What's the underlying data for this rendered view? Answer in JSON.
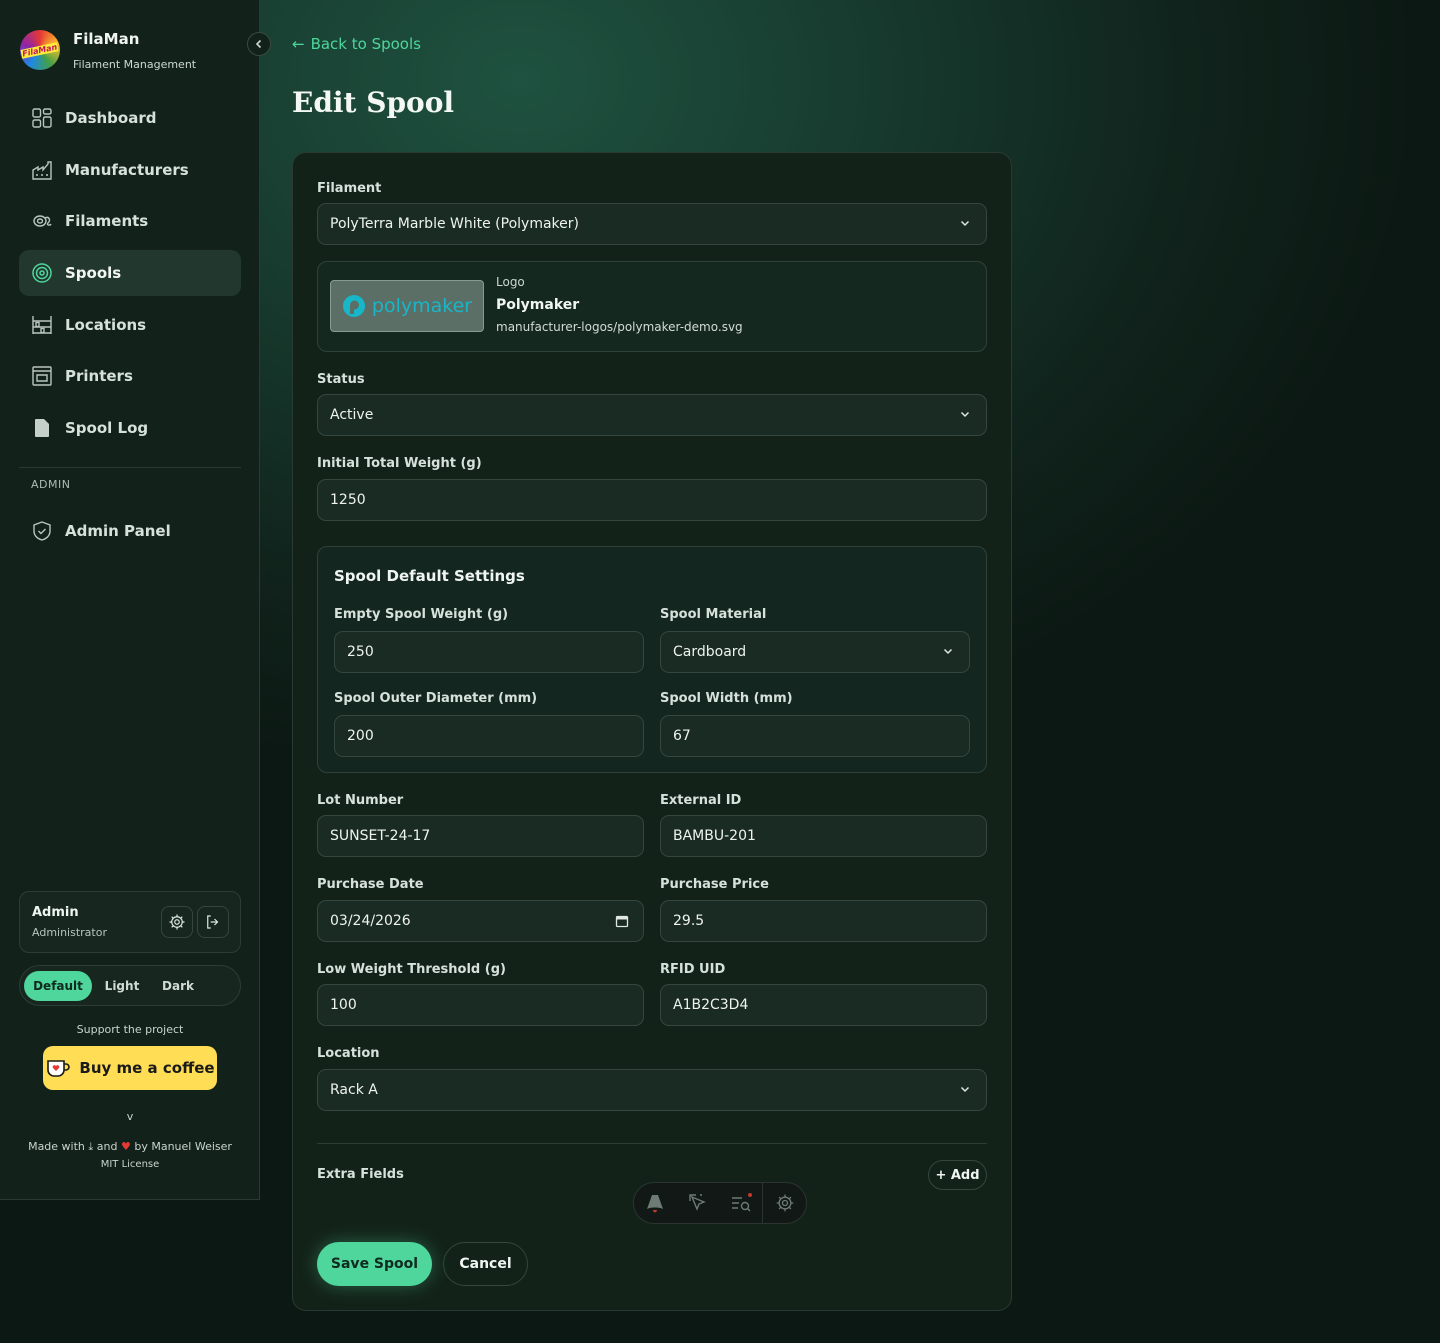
{
  "app": {
    "title": "FilaMan",
    "subtitle": "Filament Management",
    "logo_text": "FilaMan"
  },
  "sidebar": {
    "items": [
      {
        "label": "Dashboard",
        "icon": "dashboard-icon"
      },
      {
        "label": "Manufacturers",
        "icon": "factory-icon"
      },
      {
        "label": "Filaments",
        "icon": "filament-icon"
      },
      {
        "label": "Spools",
        "icon": "spool-icon",
        "active": true
      },
      {
        "label": "Locations",
        "icon": "shelf-icon"
      },
      {
        "label": "Printers",
        "icon": "printer-icon"
      },
      {
        "label": "Spool Log",
        "icon": "document-icon"
      }
    ],
    "admin_section": "ADMIN",
    "admin_item": "Admin Panel"
  },
  "user": {
    "name": "Admin",
    "role": "Administrator"
  },
  "theme": {
    "options": [
      "Default",
      "Light",
      "Dark"
    ],
    "selected": "Default"
  },
  "support": {
    "text": "Support the project",
    "button": "Buy me a coffee"
  },
  "footer": {
    "version": "v",
    "made_prefix": "Made with",
    "made_and": "and",
    "made_by": "by Manuel Weiser",
    "license": "MIT License"
  },
  "page": {
    "back": "Back to Spools",
    "title": "Edit Spool"
  },
  "form": {
    "filament": {
      "label": "Filament",
      "value": "PolyTerra Marble White (Polymaker)"
    },
    "logo": {
      "label": "Logo",
      "name": "Polymaker",
      "path": "manufacturer-logos/polymaker-demo.svg",
      "image_text": "polymaker"
    },
    "status": {
      "label": "Status",
      "value": "Active"
    },
    "initial_weight": {
      "label": "Initial Total Weight (g)",
      "value": "1250"
    },
    "defaults": {
      "title": "Spool Default Settings",
      "empty_weight": {
        "label": "Empty Spool Weight (g)",
        "value": "250"
      },
      "material": {
        "label": "Spool Material",
        "value": "Cardboard"
      },
      "outer_diameter": {
        "label": "Spool Outer Diameter (mm)",
        "value": "200"
      },
      "width": {
        "label": "Spool Width (mm)",
        "value": "67"
      }
    },
    "lot_number": {
      "label": "Lot Number",
      "value": "SUNSET-24-17"
    },
    "external_id": {
      "label": "External ID",
      "value": "BAMBU-201"
    },
    "purchase_date": {
      "label": "Purchase Date",
      "value": "03/24/2026"
    },
    "purchase_price": {
      "label": "Purchase Price",
      "value": "29.5"
    },
    "low_threshold": {
      "label": "Low Weight Threshold (g)",
      "value": "100"
    },
    "rfid": {
      "label": "RFID UID",
      "value": "A1B2C3D4"
    },
    "location": {
      "label": "Location",
      "value": "Rack A"
    },
    "extra_fields": {
      "label": "Extra Fields",
      "add": "+ Add"
    },
    "save": "Save Spool",
    "cancel": "Cancel"
  },
  "colors": {
    "accent": "#4fd69c",
    "coffee": "#ffdd55",
    "heart": "#e53935"
  }
}
